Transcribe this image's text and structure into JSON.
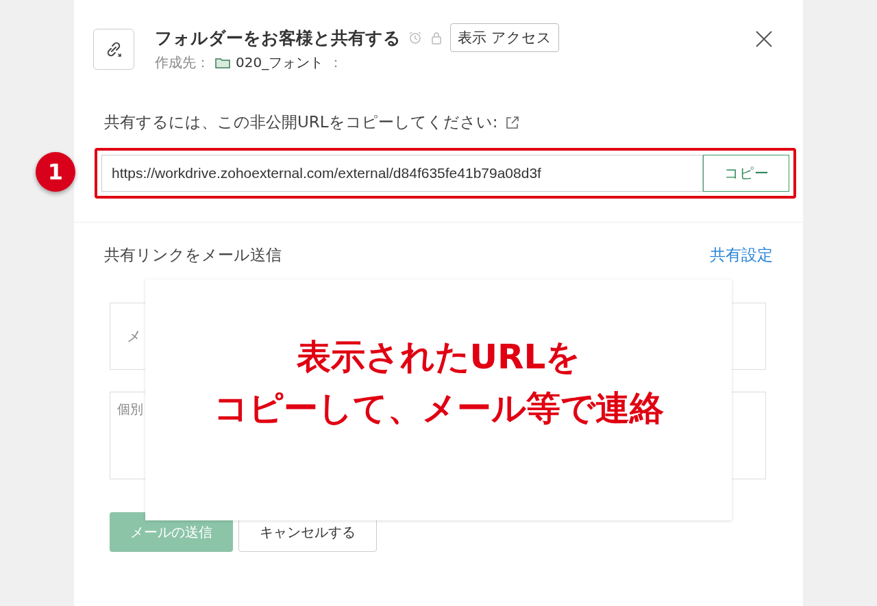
{
  "dialog": {
    "title": "フォルダーをお客様と共有する",
    "access_label": "表示 アクセス",
    "location_label": "作成先：",
    "folder": "020_フォント",
    "separator": "：",
    "instruction": "共有するには、この非公開URLをコピーしてください:",
    "url": "https://workdrive.zohoexternal.com/external/d84f635fe41b79a08d3f",
    "copy_button": "コピー",
    "step_badge": "1",
    "email_section_title": "共有リンクをメール送信",
    "share_settings_link": "共有設定",
    "email_placeholder": "メ",
    "message_placeholder": "個別",
    "buttons": [
      {
        "label": "メールの送信",
        "kind": "primary",
        "disabled": true
      },
      {
        "label": "キャンセルする",
        "kind": "secondary"
      }
    ]
  },
  "callout": {
    "lines": [
      "表示されたURLを",
      "コピーして、メール等で連絡"
    ]
  }
}
